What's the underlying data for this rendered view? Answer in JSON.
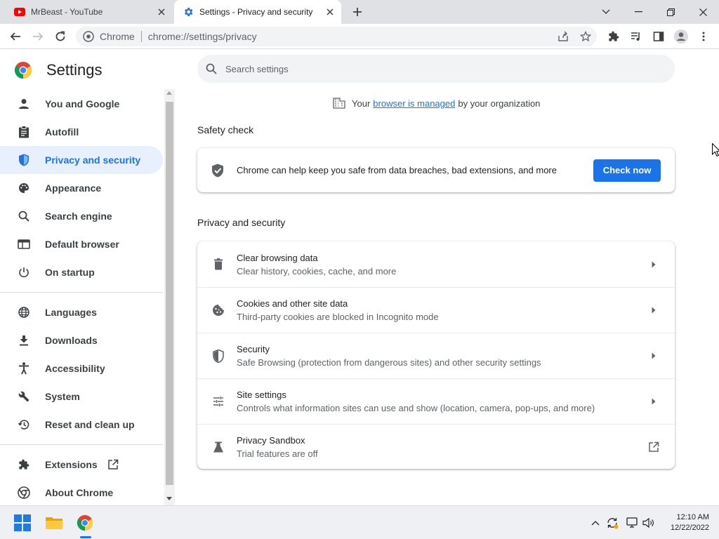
{
  "tabs": [
    {
      "title": "MrBeast - YouTube",
      "icon": "youtube-icon"
    },
    {
      "title": "Settings - Privacy and security",
      "icon": "settings-gear-icon"
    }
  ],
  "omnibox": {
    "site": "Chrome",
    "url": "chrome://settings/privacy"
  },
  "settings": {
    "title": "Settings",
    "search_placeholder": "Search settings",
    "managed": {
      "prefix": "Your",
      "link": "browser is managed",
      "suffix": "by your organization"
    }
  },
  "sidebar": {
    "items": [
      {
        "label": "You and Google",
        "icon": "person-icon"
      },
      {
        "label": "Autofill",
        "icon": "clipboard-icon"
      },
      {
        "label": "Privacy and security",
        "icon": "shield-icon",
        "active": true
      },
      {
        "label": "Appearance",
        "icon": "palette-icon"
      },
      {
        "label": "Search engine",
        "icon": "search-icon"
      },
      {
        "label": "Default browser",
        "icon": "browser-icon"
      },
      {
        "label": "On startup",
        "icon": "power-icon"
      },
      {
        "label": "Languages",
        "icon": "globe-icon"
      },
      {
        "label": "Downloads",
        "icon": "download-icon"
      },
      {
        "label": "Accessibility",
        "icon": "accessibility-icon"
      },
      {
        "label": "System",
        "icon": "wrench-icon"
      },
      {
        "label": "Reset and clean up",
        "icon": "history-icon"
      },
      {
        "label": "Extensions",
        "icon": "puzzle-icon"
      },
      {
        "label": "About Chrome",
        "icon": "chrome-logo-icon"
      }
    ]
  },
  "safety_check": {
    "title": "Safety check",
    "text": "Chrome can help keep you safe from data breaches, bad extensions, and more",
    "button": "Check now"
  },
  "privacy": {
    "title": "Privacy and security",
    "rows": [
      {
        "title": "Clear browsing data",
        "subtitle": "Clear history, cookies, cache, and more",
        "icon": "trash-icon"
      },
      {
        "title": "Cookies and other site data",
        "subtitle": "Third-party cookies are blocked in Incognito mode",
        "icon": "cookie-icon"
      },
      {
        "title": "Security",
        "subtitle": "Safe Browsing (protection from dangerous sites) and other security settings",
        "icon": "shield-half-icon"
      },
      {
        "title": "Site settings",
        "subtitle": "Controls what information sites can use and show (location, camera, pop-ups, and more)",
        "icon": "tune-icon"
      },
      {
        "title": "Privacy Sandbox",
        "subtitle": "Trial features are off",
        "icon": "flask-icon"
      }
    ]
  },
  "taskbar": {
    "time": "12:10 AM",
    "date": "12/22/2022"
  },
  "colors": {
    "accent": "#1a73e8",
    "active_bg": "#e8f0fe"
  }
}
